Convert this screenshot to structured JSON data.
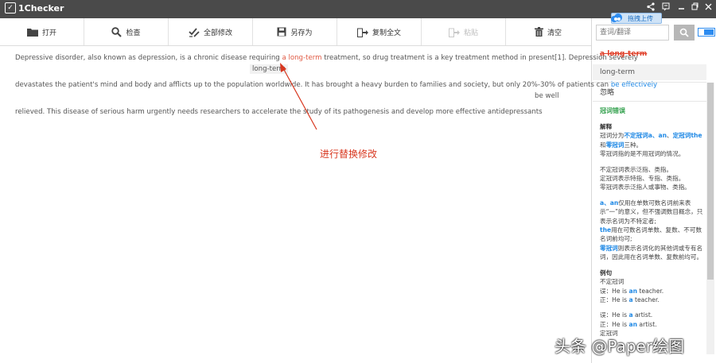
{
  "app": {
    "title": "1Checker"
  },
  "toolbar": {
    "items": [
      {
        "label": "打开",
        "icon": "folder-icon"
      },
      {
        "label": "检查",
        "icon": "search-icon"
      },
      {
        "label": "全部修改",
        "icon": "check-edit-icon"
      },
      {
        "label": "另存为",
        "icon": "save-icon"
      },
      {
        "label": "复制全文",
        "icon": "copy-icon"
      },
      {
        "label": "粘贴",
        "icon": "paste-icon",
        "disabled": true
      },
      {
        "label": "清空",
        "icon": "trash-icon"
      }
    ]
  },
  "upload_label": "拖拽上传",
  "editor": {
    "line1_a": "Depressive disorder, also known as depression, is a chronic disease requiring ",
    "line1_flag": "a long-term",
    "line1_b": " treatment, so drug treatment is a key treatment method in present[1]. Depression severely",
    "suggestion1": "long-term",
    "line2_a": "devastates the patient's mind and body and afflicts up to the population worldwide. It has brought a heavy burden to families and society, but only 20%-30% of patients can ",
    "line2_flag": "be effectively",
    "suggestion2": "be well",
    "line3": "relieved. This disease of serious harm urgently needs researchers to accelerate the study of its pathogenesis and develop more effective antidepressants"
  },
  "annotation": "进行替换修改",
  "panel": {
    "search_placeholder": "查词/翻译",
    "original": "a long-term",
    "suggestion": "long-term",
    "ignore": "忽略",
    "category": "冠词错误",
    "explain_title": "解释",
    "explain_l1_a": "冠词分为",
    "explain_l1_b": "不定冠词a、an",
    "explain_l1_c": "、",
    "explain_l1_d": "定冠词the",
    "explain_l2_a": "和",
    "explain_l2_b": "零冠词",
    "explain_l2_c": "三种。",
    "explain_l3": "零冠词指的是不用冠词的情况。",
    "p2_l1": "不定冠词表示泛指、类指。",
    "p2_l2": "定冠词表示特指、专指、类指。",
    "p2_l3": "零冠词表示泛指人或事物、类指。",
    "p3_a": "a、an",
    "p3_b": "仅用在单数可数名词前来表示“一”的意义，但不强调数目概念，只表示名词为不特定者;",
    "p3_c": "the",
    "p3_d": "用在可数名词单数、复数、不可数名词前均可;",
    "p3_e": "零冠词",
    "p3_f": "则表示名词化的其他词或专有名词，因此用在名词单数、复数前均可。",
    "example_title": "例句",
    "ex_l1": "不定冠词",
    "ex_l2_a": "误：He is ",
    "ex_l2_b": "an",
    "ex_l2_c": " teacher.",
    "ex_l3_a": "正：He is ",
    "ex_l3_b": "a",
    "ex_l3_c": " teacher.",
    "ex_l4_a": "误：He is ",
    "ex_l4_b": "a",
    "ex_l4_c": " artist.",
    "ex_l5_a": "正：He is ",
    "ex_l5_b": "an",
    "ex_l5_c": " artist.",
    "ex_l6": "定冠词"
  },
  "watermark": "头条 @Paper绘图",
  "colors": {
    "accent": "#1e88e5",
    "error": "#e05a44",
    "category": "#2e9e49",
    "titlebar": "#4a4a4a"
  }
}
